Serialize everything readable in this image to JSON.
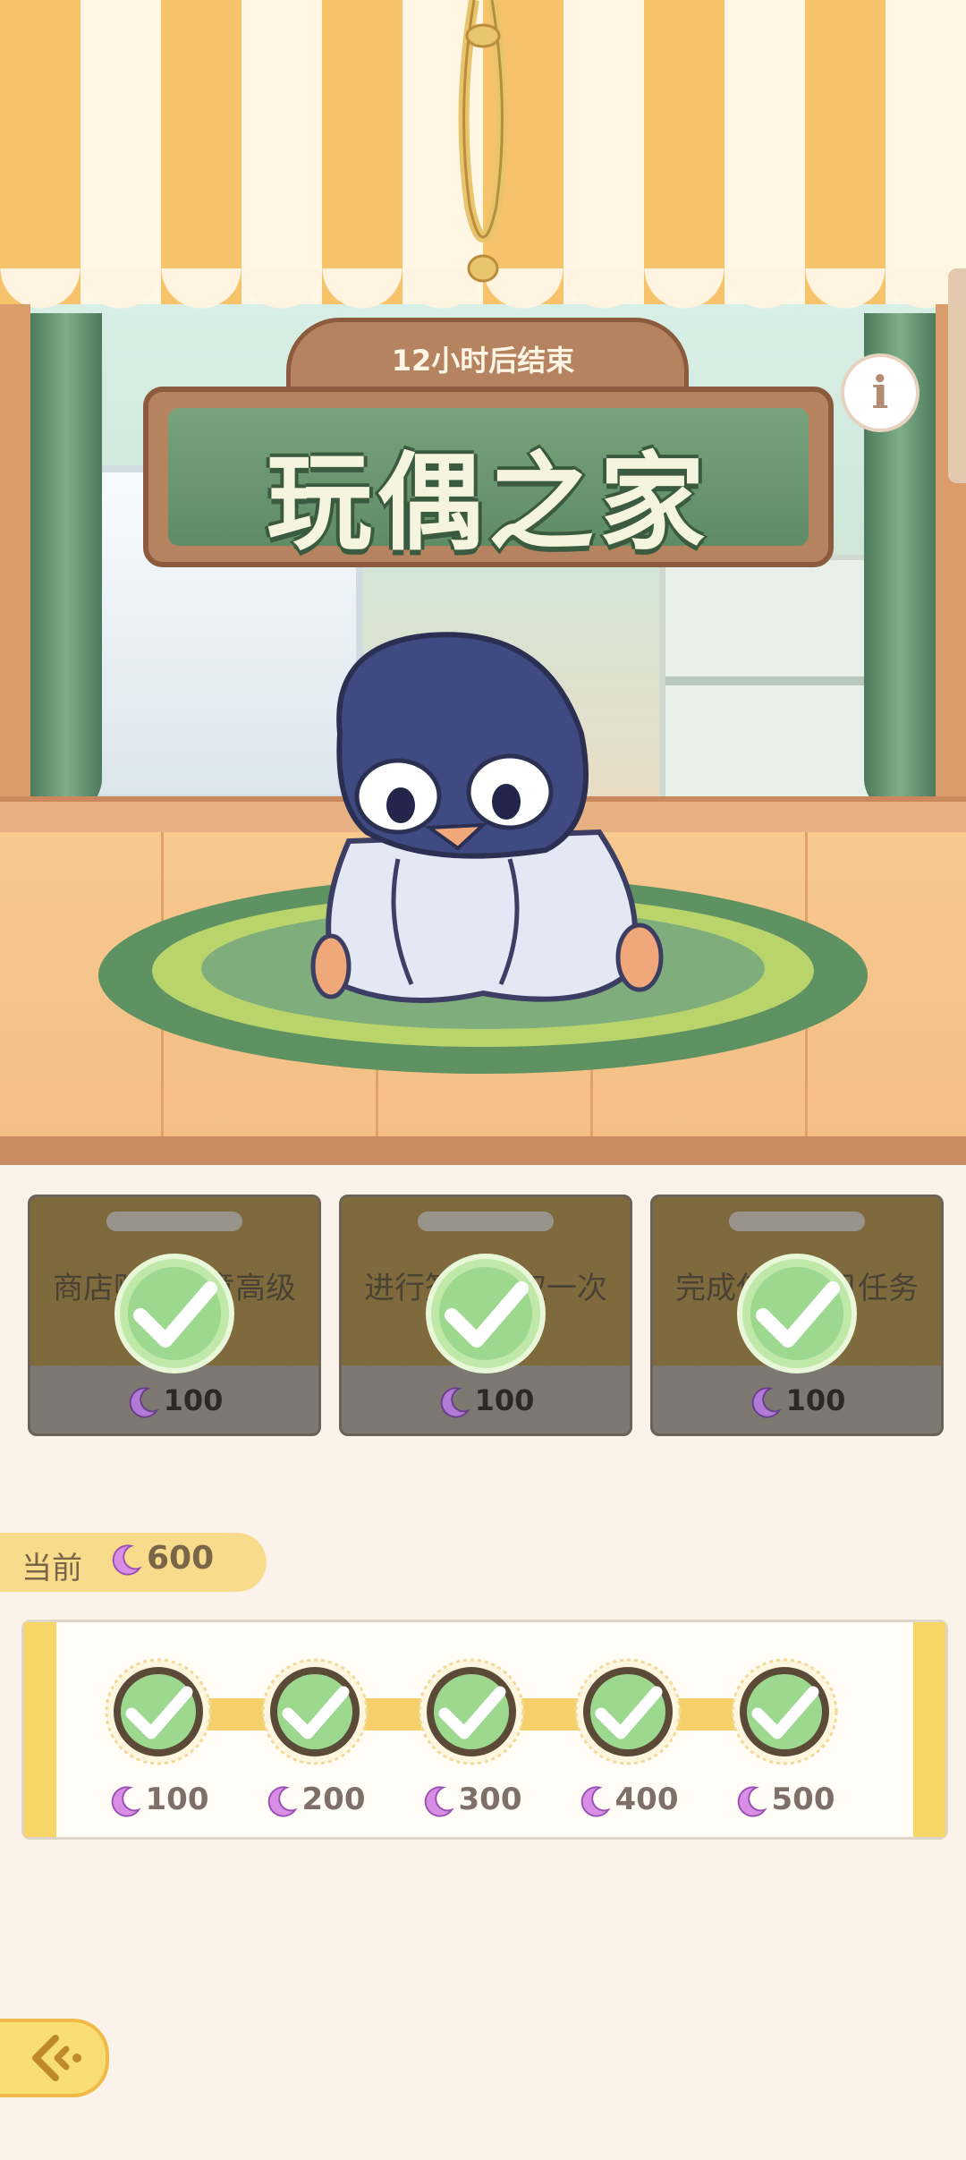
{
  "banner": {
    "timer": "12小时后结束",
    "title": "玩偶之家"
  },
  "tasks": [
    {
      "text": "商店购买任意高级盲盒代币",
      "reward": "100",
      "status": "completed"
    },
    {
      "text": "进行签到领取一次",
      "reward": "100",
      "status": "completed"
    },
    {
      "text": "完成任意每日任务",
      "reward": "100",
      "status": "completed"
    }
  ],
  "current": {
    "label": "当前",
    "value": "600"
  },
  "milestones": [
    {
      "value": "100",
      "status": "claimed"
    },
    {
      "value": "200",
      "status": "claimed"
    },
    {
      "value": "300",
      "status": "claimed"
    },
    {
      "value": "400",
      "status": "claimed"
    },
    {
      "value": "500",
      "status": "claimed"
    }
  ],
  "colors": {
    "check_fill": "#9dd88f",
    "check_ring": "#5b4a38",
    "currency": "#c07bd6",
    "accent_yellow": "#f8d567"
  },
  "icons": {
    "currency": "moon-icon",
    "info": "info-icon",
    "back": "back-arrow-icon"
  }
}
